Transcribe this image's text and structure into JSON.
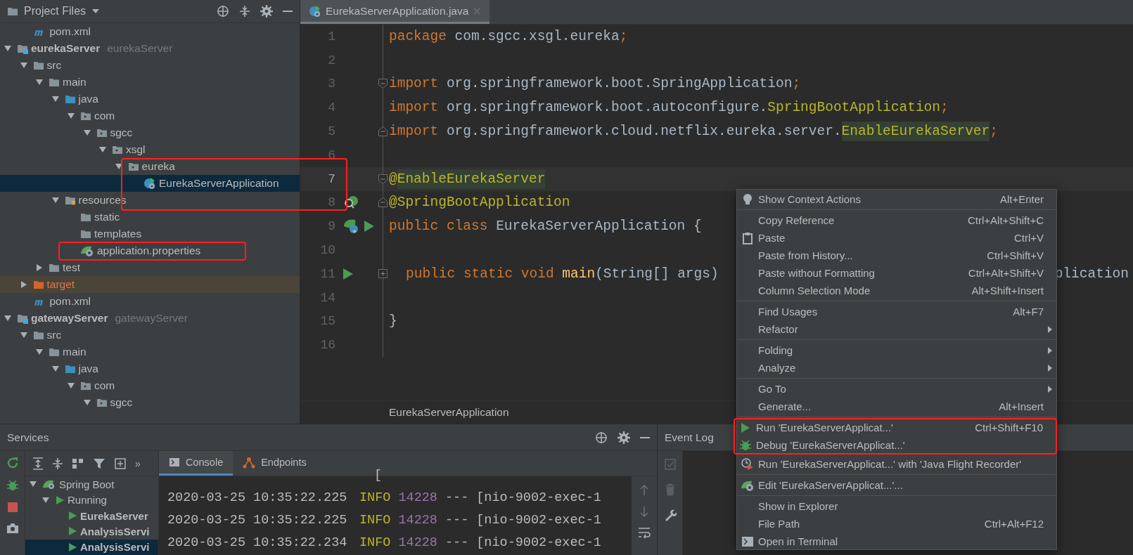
{
  "project_panel": {
    "title": "Project Files",
    "leading_items": [
      {
        "label": "pom.xml",
        "kind": "maven",
        "selected": false
      }
    ],
    "tree": [
      {
        "label": "eurekaServer",
        "secondary": "eurekaServer",
        "kind": "module",
        "expanded": true,
        "selected": false,
        "children": [
          {
            "label": "src",
            "kind": "folder",
            "expanded": true,
            "selected": false,
            "children": [
              {
                "label": "main",
                "kind": "folder",
                "expanded": true,
                "selected": false,
                "children": [
                  {
                    "label": "java",
                    "kind": "source",
                    "expanded": true,
                    "selected": false,
                    "children": [
                      {
                        "label": "com",
                        "kind": "package",
                        "expanded": true,
                        "selected": false,
                        "children": [
                          {
                            "label": "sgcc",
                            "kind": "package",
                            "expanded": true,
                            "selected": false,
                            "children": [
                              {
                                "label": "xsgl",
                                "kind": "package",
                                "expanded": true,
                                "selected": false,
                                "children": [
                                  {
                                    "label": "eureka",
                                    "kind": "package",
                                    "expanded": true,
                                    "selected": false,
                                    "children": [
                                      {
                                        "label": "EurekaServerApplication",
                                        "kind": "spring-class",
                                        "selected": true
                                      }
                                    ]
                                  }
                                ]
                              }
                            ]
                          }
                        ]
                      }
                    ]
                  },
                  {
                    "label": "resources",
                    "kind": "resources",
                    "expanded": true,
                    "selected": false,
                    "children": [
                      {
                        "label": "static",
                        "kind": "folder",
                        "selected": false
                      },
                      {
                        "label": "templates",
                        "kind": "folder",
                        "selected": false
                      },
                      {
                        "label": "application.properties",
                        "kind": "spring-config",
                        "selected": false
                      }
                    ]
                  }
                ]
              },
              {
                "label": "test",
                "kind": "folder",
                "expanded": false,
                "selected": false
              }
            ]
          },
          {
            "label": "target",
            "kind": "excluded",
            "expanded": false,
            "selected": false
          },
          {
            "label": "pom.xml",
            "kind": "maven",
            "selected": false
          }
        ]
      },
      {
        "label": "gatewayServer",
        "secondary": "gatewayServer",
        "kind": "module",
        "expanded": true,
        "selected": false,
        "children": [
          {
            "label": "src",
            "kind": "folder",
            "expanded": true,
            "selected": false,
            "children": [
              {
                "label": "main",
                "kind": "folder",
                "expanded": true,
                "selected": false,
                "children": [
                  {
                    "label": "java",
                    "kind": "source",
                    "expanded": true,
                    "selected": false,
                    "children": [
                      {
                        "label": "com",
                        "kind": "package",
                        "expanded": true,
                        "selected": false,
                        "children": [
                          {
                            "label": "sgcc",
                            "kind": "package",
                            "expanded": true,
                            "selected": false
                          }
                        ]
                      }
                    ]
                  }
                ]
              }
            ]
          }
        ]
      }
    ]
  },
  "editor": {
    "tabs": [
      {
        "label": "EurekaServerApplication.java",
        "selected": true
      }
    ],
    "lines": [
      {
        "number": "1",
        "tokens": [
          {
            "text": "package",
            "kind": "keyword"
          },
          {
            "text": "com.sgcc.xsgl.eureka",
            "kind": "plain",
            "space_before": true
          },
          {
            "text": ";",
            "kind": "keyword"
          }
        ]
      },
      {
        "number": "2"
      },
      {
        "number": "3",
        "fold_marker": {
          "kind": "start"
        },
        "tokens": [
          {
            "text": "import",
            "kind": "keyword"
          },
          {
            "text": "org.springframework.boot.SpringApplication",
            "kind": "plain",
            "space_before": true
          },
          {
            "text": ";",
            "kind": "keyword"
          }
        ]
      },
      {
        "number": "4",
        "tokens": [
          {
            "text": "import",
            "kind": "keyword"
          },
          {
            "text": "org.springframework.boot.autoconfigure.",
            "kind": "plain",
            "space_before": true
          },
          {
            "text": "SpringBootApplication",
            "kind": "annotation"
          },
          {
            "text": ";",
            "kind": "keyword"
          }
        ]
      },
      {
        "number": "5",
        "fold_marker": {
          "kind": "end"
        },
        "tokens": [
          {
            "text": "import",
            "kind": "keyword"
          },
          {
            "text": "org.springframework.cloud.netflix.eureka.server.",
            "kind": "plain",
            "space_before": true
          },
          {
            "text": "EnableEurekaServer",
            "kind": "annotation-highlight"
          },
          {
            "text": ";",
            "kind": "keyword"
          }
        ]
      },
      {
        "number": "6"
      },
      {
        "number": "7",
        "current": true,
        "fold_marker": {
          "kind": "start"
        },
        "tokens": [
          {
            "text": "@",
            "kind": "annotation"
          },
          {
            "text": "EnableEurekaServer",
            "kind": "annotation-highlight"
          }
        ]
      },
      {
        "number": "8",
        "current": false,
        "fold_marker": {
          "kind": "end"
        },
        "gutter_icons": [
          {
            "kind": "bean-search"
          }
        ],
        "tokens": [
          {
            "text": "@SpringBootApplication",
            "kind": "annotation"
          }
        ]
      },
      {
        "number": "9",
        "gutter_icons": [
          {
            "kind": "bean"
          },
          {
            "kind": "run"
          }
        ],
        "tokens": [
          {
            "text": "public class",
            "kind": "keyword"
          },
          {
            "text": "EurekaServerApplication {",
            "kind": "plain",
            "space_before": true
          }
        ]
      },
      {
        "number": "10"
      },
      {
        "number": "11",
        "gutter_icons": [
          {
            "kind": "run"
          }
        ],
        "fold_marker": {
          "kind": "collapsed"
        },
        "tokens": [
          {
            "text": "public static void",
            "kind": "keyword"
          },
          {
            "text": "main",
            "kind": "method",
            "space_before": true
          },
          {
            "text": "(String[] args)",
            "kind": "plain"
          }
        ],
        "tail": "plication"
      },
      {
        "number": "14"
      },
      {
        "number": "15",
        "tokens": [
          {
            "text": "}",
            "kind": "plain"
          }
        ]
      },
      {
        "number": "16"
      }
    ],
    "breadcrumb": "EurekaServerApplication"
  },
  "services": {
    "title": "Services",
    "toolbar_overflow": "»",
    "tree": [
      {
        "label": "Spring Boot",
        "kind": "spring",
        "expanded": true,
        "selected": false,
        "children": [
          {
            "label": "Running",
            "kind": "run",
            "expanded": true,
            "selected": false,
            "bold": false,
            "children": [
              {
                "label": "EurekaServer",
                "kind": "run",
                "selected": false,
                "bold": true
              },
              {
                "label": "AnalysisServi",
                "kind": "run",
                "selected": false,
                "bold": true
              },
              {
                "label": "AnalysisServi",
                "kind": "run",
                "selected": true,
                "bold": true
              }
            ]
          }
        ]
      }
    ],
    "console_tabs": [
      {
        "label": "Console",
        "kind": "console",
        "selected": true
      },
      {
        "label": "Endpoints",
        "kind": "endpoints",
        "selected": false
      }
    ],
    "console_lines": [
      {
        "thread": "["
      },
      {
        "timestamp": "2020-03-25 10:35:22.225",
        "level": "INFO",
        "pid": "14228",
        "sep": "---",
        "thread": "[nio-9002-exec-1"
      },
      {
        "timestamp": "2020-03-25 10:35:22.225",
        "level": "INFO",
        "pid": "14228",
        "sep": "---",
        "thread": "[nio-9002-exec-1"
      },
      {
        "timestamp": "2020-03-25 10:35:22.234",
        "level": "INFO",
        "pid": "14228",
        "sep": "---",
        "thread": "[nio-9002-exec-1"
      }
    ]
  },
  "event_log": {
    "title": "Event Log"
  },
  "context_menu": {
    "groups": [
      [
        {
          "label": "Show Context Actions",
          "shortcut": "Alt+Enter",
          "kind": "bulb"
        }
      ],
      [
        {
          "label": "Copy Reference",
          "shortcut": "Ctrl+Alt+Shift+C"
        },
        {
          "label": "Paste",
          "shortcut": "Ctrl+V",
          "kind": "clipboard"
        },
        {
          "label": "Paste from History...",
          "shortcut": "Ctrl+Shift+V"
        },
        {
          "label": "Paste without Formatting",
          "shortcut": "Ctrl+Alt+Shift+V"
        },
        {
          "label": "Column Selection Mode",
          "shortcut": "Alt+Shift+Insert"
        }
      ],
      [
        {
          "label": "Find Usages",
          "shortcut": "Alt+F7"
        },
        {
          "label": "Refactor",
          "submenu": true
        }
      ],
      [
        {
          "label": "Folding",
          "submenu": true
        },
        {
          "label": "Analyze",
          "submenu": true
        }
      ],
      [
        {
          "label": "Go To",
          "submenu": true
        },
        {
          "label": "Generate...",
          "shortcut": "Alt+Insert"
        }
      ],
      [
        {
          "label": "Run 'EurekaServerApplicat...'",
          "shortcut": "Ctrl+Shift+F10",
          "kind": "run",
          "highlighted": true
        },
        {
          "label": "Debug 'EurekaServerApplicat...'",
          "kind": "debug",
          "highlighted": true
        },
        {
          "label": "Run 'EurekaServerApplicat...' with 'Java Flight Recorder'",
          "kind": "profile",
          "highlighted": false
        }
      ],
      [
        {
          "label": "Edit 'EurekaServerApplicat...'...",
          "kind": "spring-edit"
        }
      ],
      [
        {
          "label": "Show in Explorer"
        },
        {
          "label": "File Path",
          "shortcut": "Ctrl+Alt+F12"
        },
        {
          "label": "Open in Terminal",
          "kind": "terminal"
        }
      ]
    ]
  }
}
